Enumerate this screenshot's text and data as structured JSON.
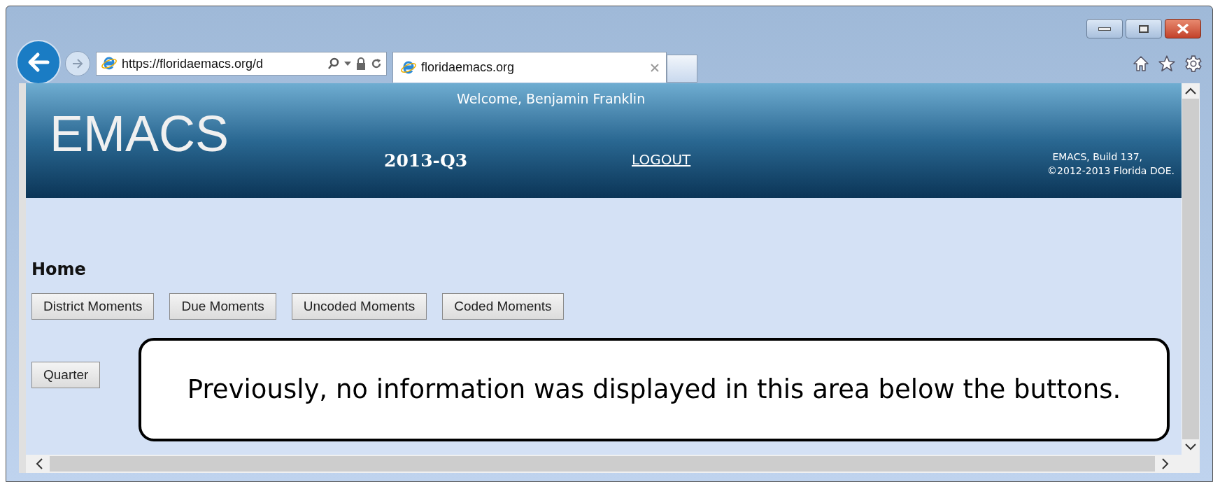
{
  "browser": {
    "address": "https://floridaemacs.org/d",
    "tab_title": "floridaemacs.org"
  },
  "header": {
    "logo": "EMACS",
    "welcome": "Welcome, Benjamin Franklin",
    "quarter": "2013-Q3",
    "logout": "LOGOUT",
    "build_lines": [
      "EMACS, Build 137,",
      "©2012-2013 Florida DOE."
    ]
  },
  "page": {
    "heading": "Home",
    "buttons": [
      "District Moments",
      "Due Moments",
      "Uncoded Moments",
      "Coded Moments"
    ],
    "quarter_button": "Quarter"
  },
  "callout": "Previously, no information was displayed in this area below the buttons."
}
